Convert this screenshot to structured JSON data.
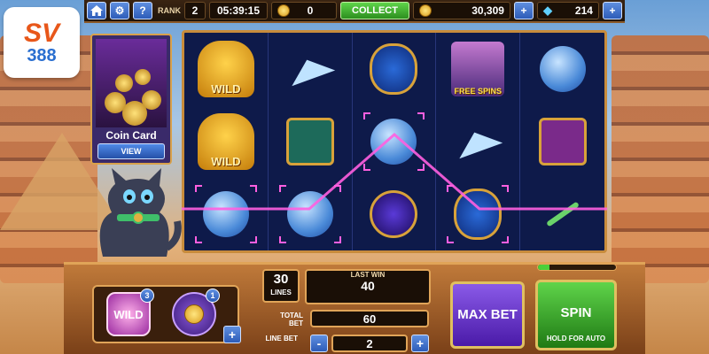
{
  "logo": {
    "top_text": "SV",
    "bottom_text": "388"
  },
  "topbar": {
    "home_icon": "home-icon",
    "settings_icon": "gear-icon",
    "help_label": "?",
    "rank_label": "RANK",
    "rank_value": "2",
    "timer": "05:39:15",
    "bonus_coins": "0",
    "collect_label": "COLLECT",
    "coins": "30,309",
    "gems": "214",
    "plus_label": "+"
  },
  "coin_card": {
    "label": "Coin Card",
    "view_label": "VIEW"
  },
  "reels": {
    "symbols": [
      [
        "wild-cat",
        "paper-plane",
        "scarab",
        "free-spins-lady",
        "yarn-ball"
      ],
      [
        "wild-cat",
        "mouse-tile",
        "yarn-ball",
        "paper-plane",
        "snake-tile"
      ],
      [
        "yarn-ball",
        "yarn-ball",
        "gyroscope",
        "scarab",
        "feather"
      ]
    ],
    "wild_label": "WILD",
    "free_spins_label": "FREE SPINS",
    "highlighted": [
      [
        2,
        0
      ],
      [
        2,
        1
      ],
      [
        1,
        2
      ],
      [
        2,
        3
      ]
    ]
  },
  "boosts": {
    "wild_label": "WILD",
    "wild_count": "3",
    "coins_count": "1",
    "plus_label": "+"
  },
  "bet": {
    "lines_value": "30",
    "lines_label": "LINES",
    "last_win_label": "LAST WIN",
    "last_win_value": "40",
    "total_bet_label": "TOTAL BET",
    "total_bet_value": "60",
    "line_bet_label": "LINE BET",
    "line_bet_value": "2",
    "minus_label": "-",
    "plus_label": "+"
  },
  "buttons": {
    "max_bet_label": "MAX BET",
    "spin_label": "SPIN",
    "hold_label": "HOLD FOR AUTO"
  },
  "progress": {
    "fraction": 0.15
  },
  "colors": {
    "payline": "#ff5fe0",
    "accent_gold": "#e0a458"
  }
}
